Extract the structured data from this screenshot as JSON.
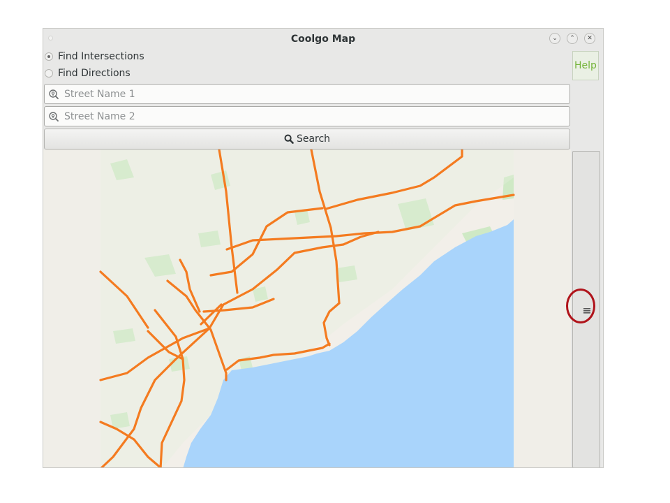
{
  "window": {
    "title": "Coolgo Map",
    "buttons": [
      "minimize-icon",
      "maximize-icon",
      "close-icon"
    ]
  },
  "modes": {
    "find_intersections": "Find Intersections",
    "find_directions": "Find Directions",
    "selected": "find_intersections"
  },
  "help_label": "Help",
  "search": {
    "street1_placeholder": "Street Name 1",
    "street2_placeholder": "Street Name 2",
    "street1_value": "",
    "street2_value": "",
    "button_label": "Search"
  },
  "map": {
    "water_color": "#a9d4fb",
    "land_color": "#f2efe9",
    "park_color": "#cfe9c5",
    "road_color": "#f47b20"
  },
  "annotation": {
    "highlight": "scrollbar-grip",
    "color": "#b0141b"
  },
  "colors": {
    "help_text": "#73b339"
  }
}
